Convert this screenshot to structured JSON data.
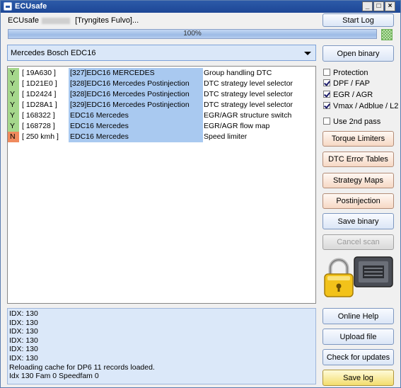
{
  "window": {
    "title": "ECUsafe"
  },
  "header": {
    "app_name": "ECUsafe",
    "status_text": "[Tryngites Fulvo]...",
    "start_log_label": "Start Log"
  },
  "progress": {
    "value_percent": 100,
    "label": "100%"
  },
  "ecu": {
    "selected": "Mercedes Bosch EDC16",
    "open_binary_label": "Open binary"
  },
  "patches": [
    {
      "flag": "Y",
      "addr": "[ 19A630 ]",
      "name": "[327]EDC16 MERCEDES",
      "desc": "Group handling DTC"
    },
    {
      "flag": "Y",
      "addr": "[ 1D21E0 ]",
      "name": "[328]EDC16 Mercedes Postinjection",
      "desc": "DTC strategy level selector"
    },
    {
      "flag": "Y",
      "addr": "[ 1D2424 ]",
      "name": "[328]EDC16 Mercedes Postinjection",
      "desc": "DTC strategy level selector"
    },
    {
      "flag": "Y",
      "addr": "[ 1D28A1 ]",
      "name": "[329]EDC16 Mercedes Postinjection",
      "desc": "DTC strategy level selector"
    },
    {
      "flag": "Y",
      "addr": "[ 168322 ]",
      "name": "EDC16 Mercedes",
      "desc": "EGR/AGR structure switch"
    },
    {
      "flag": "Y",
      "addr": "[ 168728 ]",
      "name": "EDC16 Mercedes",
      "desc": "EGR/AGR flow map"
    },
    {
      "flag": "N",
      "addr": "[ 250 kmh ]",
      "name": "EDC16 Mercedes",
      "desc": "Speed limiter"
    }
  ],
  "options": {
    "protection": {
      "label": "Protection",
      "checked": false
    },
    "dpf_fap": {
      "label": "DPF / FAP",
      "checked": true
    },
    "egr_agr": {
      "label": "EGR / AGR",
      "checked": true
    },
    "vmax": {
      "label": "Vmax / Adblue / L2",
      "checked": true
    },
    "second_pass": {
      "label": "Use 2nd pass",
      "checked": false
    }
  },
  "buttons": {
    "torque_limiters": "Torque Limiters",
    "dtc_error_tables": "DTC Error Tables",
    "strategy_maps": "Strategy Maps",
    "postinjection": "Postinjection",
    "save_binary": "Save binary",
    "cancel_scan": "Cancel scan",
    "online_help": "Online Help",
    "upload_file": "Upload file",
    "check_updates": "Check for updates",
    "save_log": "Save log"
  },
  "log": [
    "IDX: 130",
    "IDX: 130",
    "IDX: 130",
    "IDX: 130",
    "IDX: 130",
    "IDX: 130",
    "Reloading cache for DP6  11 records loaded.",
    "Idx 130 Fam 0 Speedfam 0"
  ],
  "colors": {
    "flag_yes": "#a5d78c",
    "flag_no": "#f08a5d",
    "highlight": "#a9c9f0",
    "log_bg": "#dbe8f9",
    "titlebar": "#2c5aa8"
  }
}
